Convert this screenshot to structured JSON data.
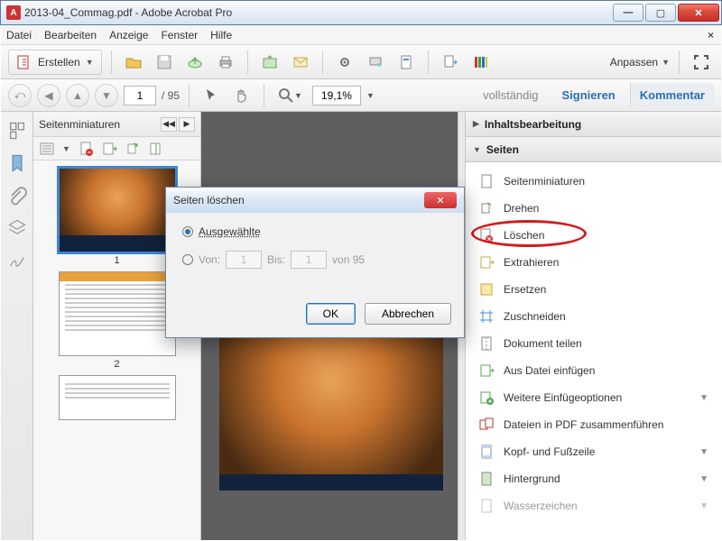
{
  "window": {
    "title": "2013-04_Commag.pdf - Adobe Acrobat Pro"
  },
  "menu": {
    "file": "Datei",
    "edit": "Bearbeiten",
    "view": "Anzeige",
    "window": "Fenster",
    "help": "Hilfe"
  },
  "toolbar": {
    "create": "Erstellen",
    "customize": "Anpassen"
  },
  "nav": {
    "page_current": "1",
    "page_total": "/ 95",
    "zoom": "19,1%",
    "link_full": "vollständig",
    "link_sign": "Signieren",
    "link_comment": "Kommentar"
  },
  "thumb_panel": {
    "title": "Seitenminiaturen",
    "pages": [
      {
        "label": "1"
      },
      {
        "label": "2"
      }
    ]
  },
  "tools_panel": {
    "section_edit": "Inhaltsbearbeitung",
    "section_pages": "Seiten",
    "items": [
      "Seitenminiaturen",
      "Drehen",
      "Löschen",
      "Extrahieren",
      "Ersetzen",
      "Zuschneiden",
      "Dokument teilen",
      "Aus Datei einfügen",
      "Weitere Einfügeoptionen",
      "Dateien in PDF zusammenführen",
      "Kopf- und Fußzeile",
      "Hintergrund",
      "Wasserzeichen"
    ]
  },
  "dialog": {
    "title": "Seiten löschen",
    "opt_selected": "Ausgewählte",
    "opt_from": "Von:",
    "from_val": "1",
    "opt_to": "Bis:",
    "to_val": "1",
    "of_total": "von 95",
    "ok": "OK",
    "cancel": "Abbrechen"
  }
}
